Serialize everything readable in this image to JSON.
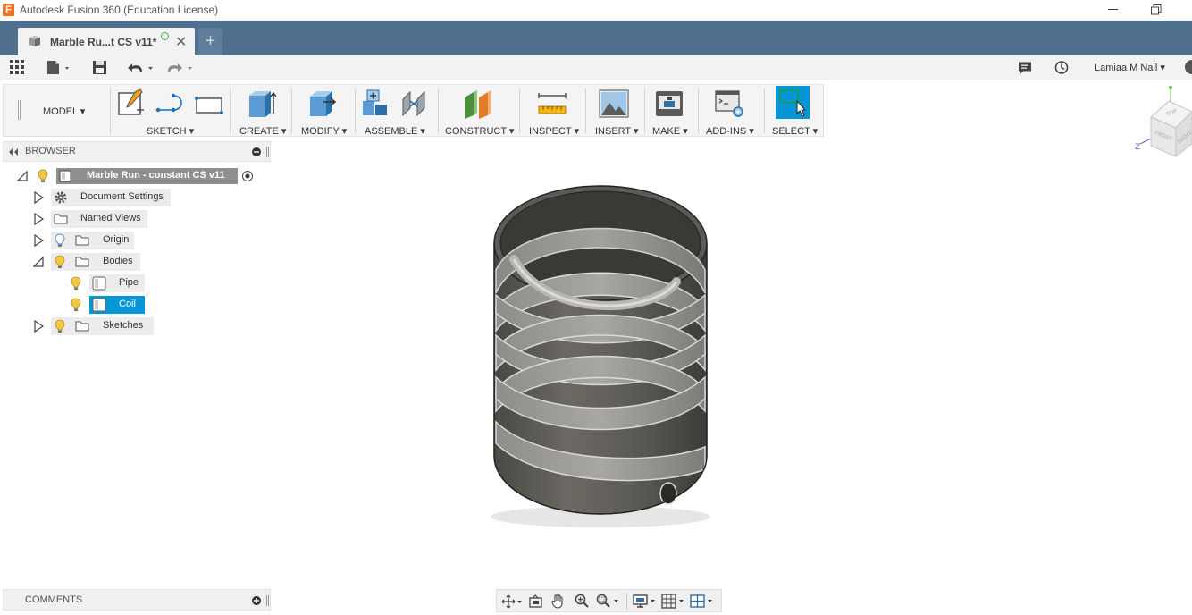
{
  "window": {
    "app_title": "Autodesk Fusion 360 (Education License)",
    "app_logo_letter": "F"
  },
  "tab": {
    "document_label": "Marble Ru...t CS v11*",
    "new_tab_symbol": "+",
    "close_symbol": "✕"
  },
  "qab": {
    "user_name": "Lamiaa M Nail ▾"
  },
  "toolbar": {
    "workspace_label": "MODEL ▾",
    "groups": [
      {
        "label": "SKETCH ▾"
      },
      {
        "label": "CREATE ▾"
      },
      {
        "label": "MODIFY ▾"
      },
      {
        "label": "ASSEMBLE ▾"
      },
      {
        "label": "CONSTRUCT ▾"
      },
      {
        "label": "INSPECT ▾"
      },
      {
        "label": "INSERT ▾"
      },
      {
        "label": "MAKE ▾"
      },
      {
        "label": "ADD-INS ▾"
      },
      {
        "label": "SELECT ▾"
      }
    ],
    "accent_color": "#0696d7"
  },
  "browser": {
    "title": "BROWSER",
    "root_label": "Marble Run - constant CS v11",
    "items": [
      {
        "label": "Document Settings"
      },
      {
        "label": "Named Views"
      },
      {
        "label": "Origin"
      },
      {
        "label": "Bodies"
      },
      {
        "label": "Pipe"
      },
      {
        "label": "Coil"
      },
      {
        "label": "Sketches"
      }
    ],
    "selected_color": "#0696d7"
  },
  "comments": {
    "title": "COMMENTS"
  },
  "viewcube": {
    "faces": [
      "TOP",
      "FRONT",
      "RIGHT"
    ],
    "axis_z": "Z"
  }
}
